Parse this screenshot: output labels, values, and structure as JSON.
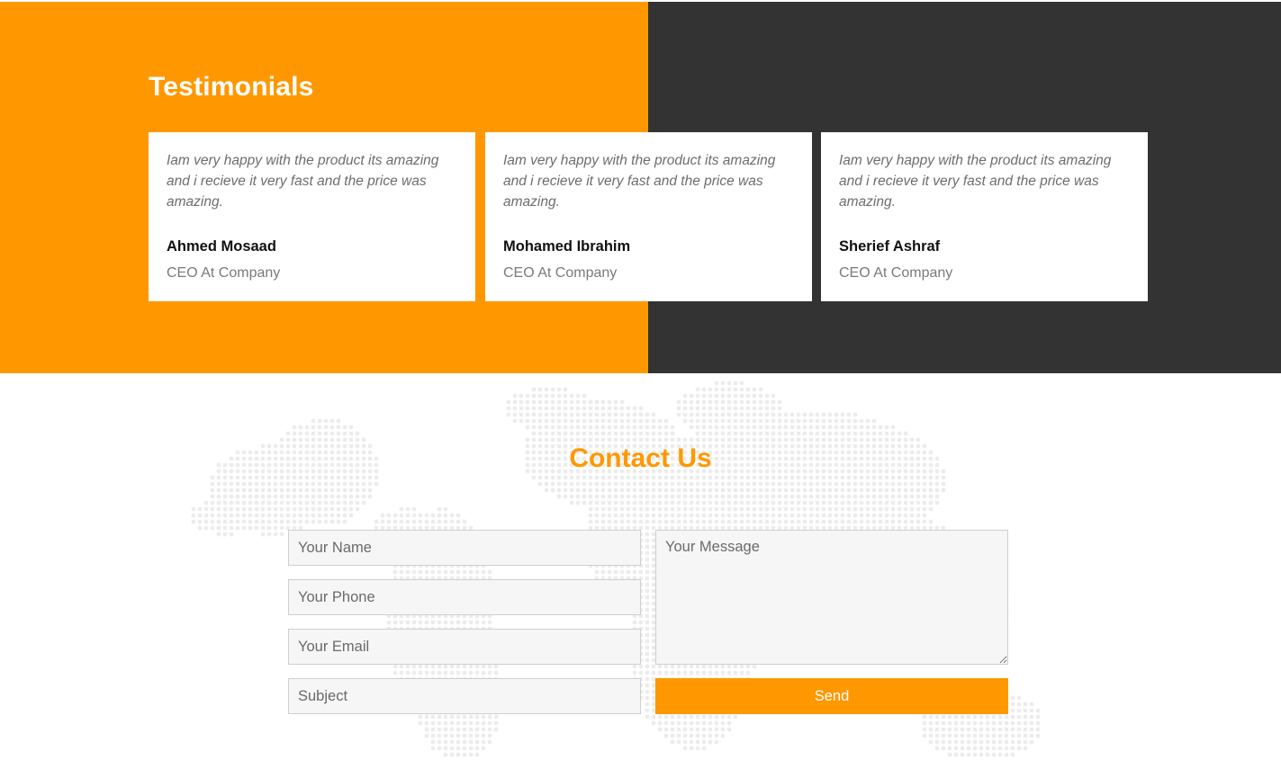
{
  "colors": {
    "accent": "#ff9800",
    "dark": "#333333",
    "card_bg": "#ffffff",
    "input_bg": "#f6f6f6"
  },
  "testimonials": {
    "title": "Testimonials",
    "items": [
      {
        "quote": "Iam very happy with the product its amazing and i recieve it very fast and the price was amazing.",
        "name": "Ahmed Mosaad",
        "role": "CEO At Company"
      },
      {
        "quote": "Iam very happy with the product its amazing and i recieve it very fast and the price was amazing.",
        "name": "Mohamed Ibrahim",
        "role": "CEO At Company"
      },
      {
        "quote": "Iam very happy with the product its amazing and i recieve it very fast and the price was amazing.",
        "name": "Sherief Ashraf",
        "role": "CEO At Company"
      }
    ]
  },
  "contact": {
    "title": "Contact Us",
    "name_placeholder": "Your Name",
    "phone_placeholder": "Your Phone",
    "email_placeholder": "Your Email",
    "subject_placeholder": "Subject",
    "message_placeholder": "Your Message",
    "send_label": "Send",
    "background_icon": "world-map-dots"
  }
}
